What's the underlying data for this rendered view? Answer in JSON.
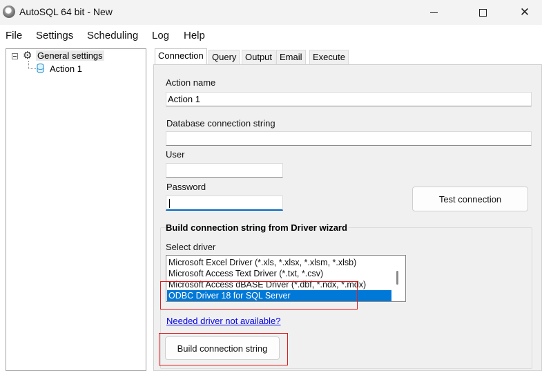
{
  "window": {
    "title": "AutoSQL 64 bit - New",
    "minimize_icon": "minimize-icon",
    "maximize_icon": "maximize-icon",
    "close_glyph": "✕"
  },
  "menu": [
    "File",
    "Settings",
    "Scheduling",
    "Log",
    "Help"
  ],
  "tree": {
    "root": {
      "label": "General settings",
      "icon": "gear-icon",
      "expand_glyph": "−"
    },
    "child": {
      "label": "Action 1",
      "icon": "database-icon"
    }
  },
  "tabs": [
    "Connection",
    "Query",
    "Output",
    "Email",
    "Execute"
  ],
  "active_tab": "Connection",
  "form": {
    "action_name_label": "Action name",
    "action_name_value": "Action 1",
    "db_conn_label": "Database connection string",
    "db_conn_value": "",
    "user_label": "User",
    "user_value": "",
    "password_label": "Password",
    "password_value": "",
    "test_connection": "Test connection"
  },
  "wizard": {
    "title": "Build connection string from Driver wizard",
    "select_driver_label": "Select driver",
    "drivers": [
      "Microsoft Excel Driver (*.xls, *.xlsx, *.xlsm, *.xlsb)",
      "Microsoft Access Text Driver (*.txt, *.csv)",
      "Microsoft Access dBASE Driver (*.dbf, *.ndx, *.mdx)",
      "ODBC Driver 18 for SQL Server"
    ],
    "selected_driver": "ODBC Driver 18 for SQL Server",
    "driver_link": "Needed driver not available?",
    "build_button": "Build connection string"
  },
  "colors": {
    "selection": "#0078d7",
    "highlight_annotation": "#e0191b",
    "link": "#0000ee"
  }
}
